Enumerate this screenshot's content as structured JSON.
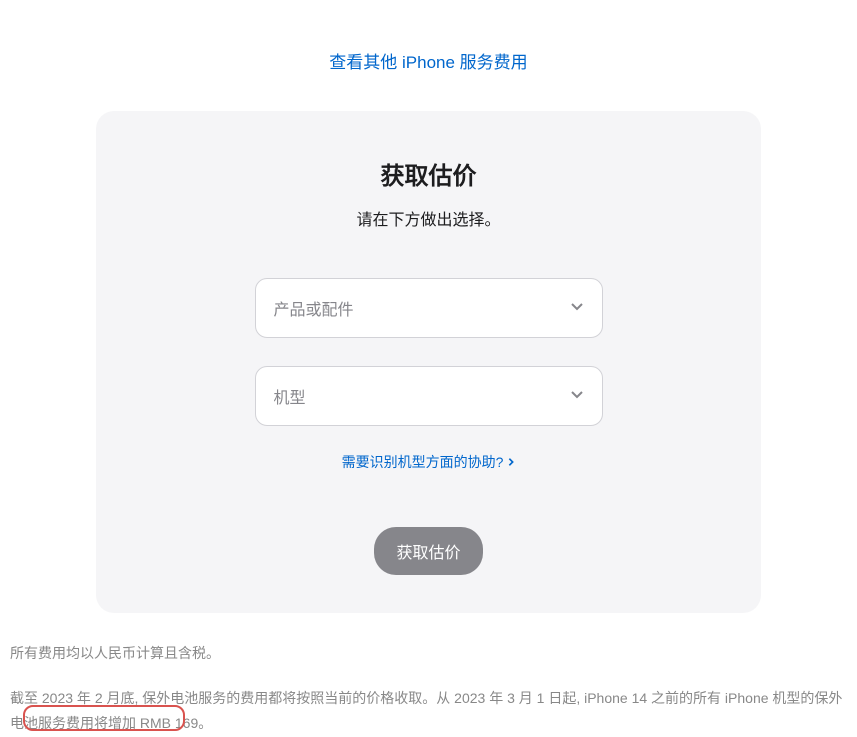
{
  "topLink": "查看其他 iPhone 服务费用",
  "card": {
    "title": "获取估价",
    "subtitle": "请在下方做出选择。",
    "productSelect": "产品或配件",
    "modelSelect": "机型",
    "helpLink": "需要识别机型方面的协助?",
    "submitButton": "获取估价"
  },
  "footer": {
    "line1": "所有费用均以人民币计算且含税。",
    "line2": "截至 2023 年 2 月底, 保外电池服务的费用都将按照当前的价格收取。从 2023 年 3 月 1 日起, iPhone 14 之前的所有 iPhone 机型的保外电池服务费用将增加 RMB 169。"
  }
}
